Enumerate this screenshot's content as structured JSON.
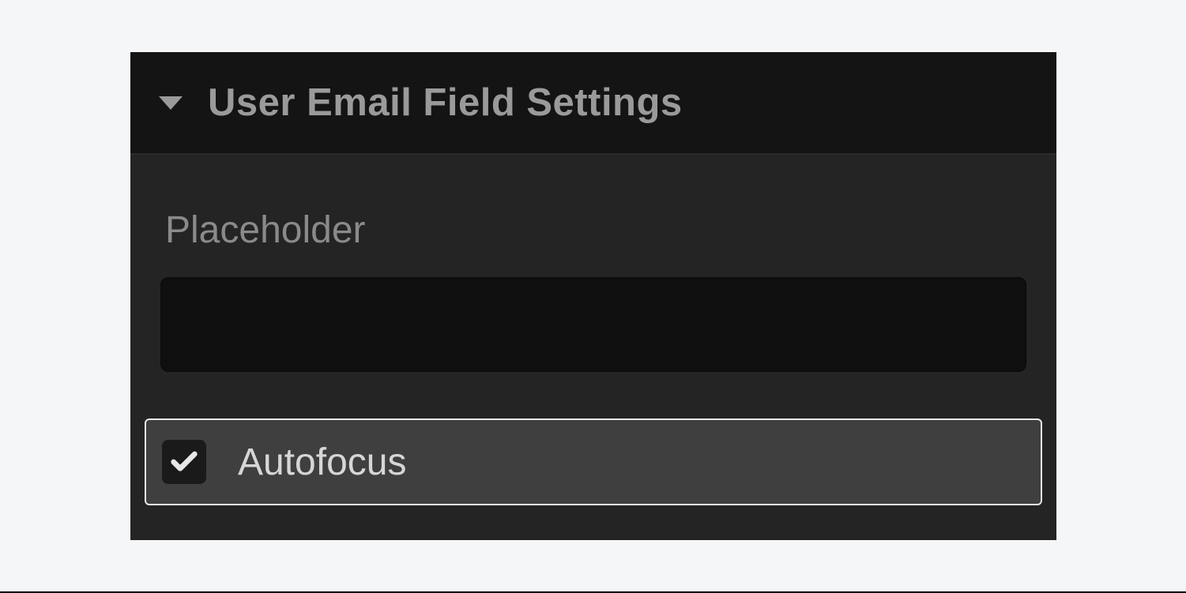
{
  "panel": {
    "title": "User Email Field Settings",
    "placeholder_label": "Placeholder",
    "placeholder_value": "",
    "autofocus_label": "Autofocus",
    "autofocus_checked": true
  }
}
